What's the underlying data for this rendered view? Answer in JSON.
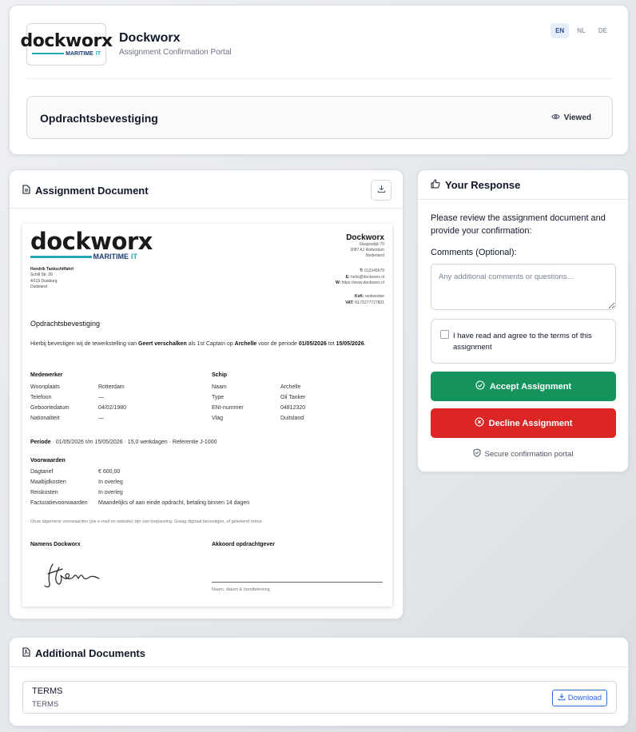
{
  "brand": {
    "logo_word": "dockworx",
    "logo_tag_main": "MARITIME",
    "logo_tag_accent": "IT",
    "name": "Dockworx",
    "subtitle": "Assignment Confirmation Portal"
  },
  "languages": [
    {
      "code": "EN",
      "active": true
    },
    {
      "code": "NL",
      "active": false
    },
    {
      "code": "DE",
      "active": false
    }
  ],
  "status": {
    "title": "Opdrachtsbevestiging",
    "badge": "Viewed"
  },
  "document_panel": {
    "title": "Assignment Document",
    "paper": {
      "company": {
        "name": "Dockworx",
        "address": [
          "Sluisjesdijk 70",
          "3087 AJ Rotterdam",
          "Nederland"
        ],
        "contact": [
          {
            "label": "T:",
            "value": "012345678"
          },
          {
            "label": "E:",
            "value": "hello@dockworx.nl"
          },
          {
            "label": "W:",
            "value": "https://www.dockworx.nl"
          }
        ],
        "registration": [
          {
            "label": "KvK:",
            "value": "eedwedwe"
          },
          {
            "label": "VAT:",
            "value": "NL76277727801"
          }
        ]
      },
      "recipient": {
        "name": "Hendrik Tankschiffahrt",
        "lines": [
          "Schill Str. 26",
          "4/119 Duisburg",
          "Duitsland"
        ]
      },
      "title": "Opdrachtsbevestiging",
      "intro": {
        "part1": "Hierbij bevestigen wij de tewerkstelling van ",
        "person": "Geert verschalken",
        "part2": " als 1st Captain op ",
        "ship": "Archelle",
        "part3": " voor de periode ",
        "start": "01/05/2026",
        "part4": " tot ",
        "end": "15/05/2026",
        "part5": "."
      },
      "employee": {
        "heading": "Medewerker",
        "rows": [
          {
            "label": "Woonplaats",
            "value": "Rotterdam"
          },
          {
            "label": "Telefoon",
            "value": "—"
          },
          {
            "label": "Geboortedatum",
            "value": "04/02/1980"
          },
          {
            "label": "Nationaliteit",
            "value": "—"
          }
        ]
      },
      "ship": {
        "heading": "Schip",
        "rows": [
          {
            "label": "Naam",
            "value": "Archelle"
          },
          {
            "label": "Type",
            "value": "Oil Tanker"
          },
          {
            "label": "ENI-nummer",
            "value": "04812320"
          },
          {
            "label": "Vlag",
            "value": "Duitsland"
          }
        ]
      },
      "period": {
        "label": "Periode",
        "text": " · 01/05/2026 t/m 15/05/2026 · 15,0 werkdagen · Referentie J-1000"
      },
      "terms": {
        "heading": "Voorwaarden",
        "rows": [
          {
            "label": "Dagtarief",
            "value": "€ 600,00"
          },
          {
            "label": "Maaltijdkosten",
            "value": "In overleg"
          },
          {
            "label": "Reiskosten",
            "value": "In overleg"
          },
          {
            "label": "Facturatievoorwaarden",
            "value": "Maandelijks of aan einde opdracht, betaling binnen 14 dagen"
          }
        ]
      },
      "note": "Onze algemene voorwaarden (zie e-mail en website) zijn van toepassing. Graag digitaal bevestigen, of getekend retour.",
      "sign_left": "Namens Dockworx",
      "sign_right": "Akkoord opdrachtgever",
      "sign_caption": "Naam, datum & handtekening"
    }
  },
  "response_panel": {
    "title": "Your Response",
    "intro": "Please review the assignment document and provide your confirmation:",
    "comments_label": "Comments (Optional):",
    "comments_placeholder": "Any additional comments or questions...",
    "terms_label": "I have read and agree to the terms of this assignment",
    "accept_label": "Accept Assignment",
    "decline_label": "Decline Assignment",
    "secure_text": "Secure confirmation portal"
  },
  "additional_docs": {
    "title": "Additional Documents",
    "items": [
      {
        "title": "TERMS",
        "subtitle": "TERMS",
        "download_label": "Download"
      }
    ]
  },
  "colors": {
    "accept": "#14935d",
    "decline": "#dc2626",
    "link": "#2563eb",
    "logo_teal": "#2aa7b4",
    "logo_navy": "#1a3d73"
  }
}
